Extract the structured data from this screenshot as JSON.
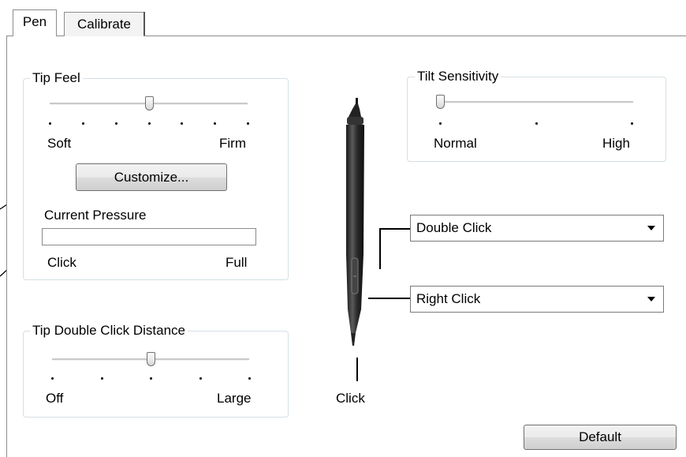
{
  "tabs": [
    {
      "label": "Pen",
      "active": true
    },
    {
      "label": "Calibrate",
      "active": false
    }
  ],
  "tip_feel": {
    "title": "Tip Feel",
    "min_label": "Soft",
    "max_label": "Firm",
    "slider_value": 0.5,
    "tick_count": 7,
    "customize_label": "Customize...",
    "current_pressure_label": "Current Pressure",
    "pressure_min_label": "Click",
    "pressure_max_label": "Full",
    "pressure_value": 0
  },
  "tip_double_click": {
    "title": "Tip Double Click Distance",
    "min_label": "Off",
    "max_label": "Large",
    "slider_value": 0.5,
    "tick_count": 5
  },
  "tilt": {
    "title": "Tilt Sensitivity",
    "min_label": "Normal",
    "max_label": "High",
    "slider_value": 0,
    "tick_count": 3
  },
  "pen": {
    "upper_button": "Double Click",
    "lower_button": "Right Click",
    "tip_label": "Click"
  },
  "default_label": "Default"
}
